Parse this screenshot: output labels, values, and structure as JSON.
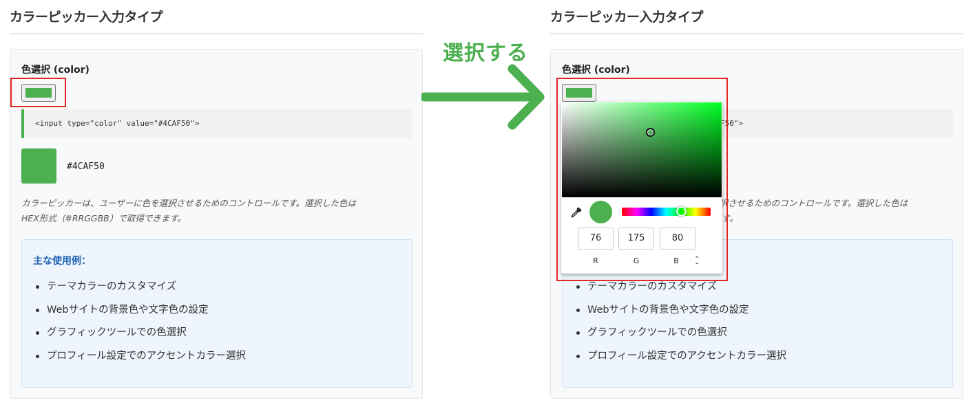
{
  "section_title": "カラーピッカー入力タイプ",
  "field_label": "色選択 (color)",
  "code_snippet": "<input type=\"color\" value=\"#4CAF50\">",
  "code_snippet_partial": "F50\">",
  "current_color": "#4CAF50",
  "hex_text": "#4CAF50",
  "description_line1": "カラーピッカーは、ユーザーに色を選択させるためのコントロールです。選択した色は",
  "description_line2": "HEX形式（#RRGGBB）で取得できます。",
  "description_partial_line1": "選択させるためのコントロールです。選択した色は",
  "description_partial_line2": "す。",
  "usage": {
    "title": "主な使用例：",
    "items": [
      "テーマカラーのカスタマイズ",
      "Webサイトの背景色や文字色の設定",
      "グラフィックツールでの色選択",
      "プロフィール設定でのアクセントカラー選択"
    ]
  },
  "annotation": {
    "arrow_label": "選択する",
    "arrow_color": "#4caf50",
    "highlight_color": "#e32626"
  },
  "picker": {
    "hue_color": "#00ff22",
    "rgb": {
      "r_value": "76",
      "g_value": "175",
      "b_value": "80",
      "r_label": "R",
      "g_label": "G",
      "b_label": "B"
    },
    "mode_toggle_icon": "up-down-chevron-icon",
    "eyedropper_icon": "eyedropper-icon"
  }
}
